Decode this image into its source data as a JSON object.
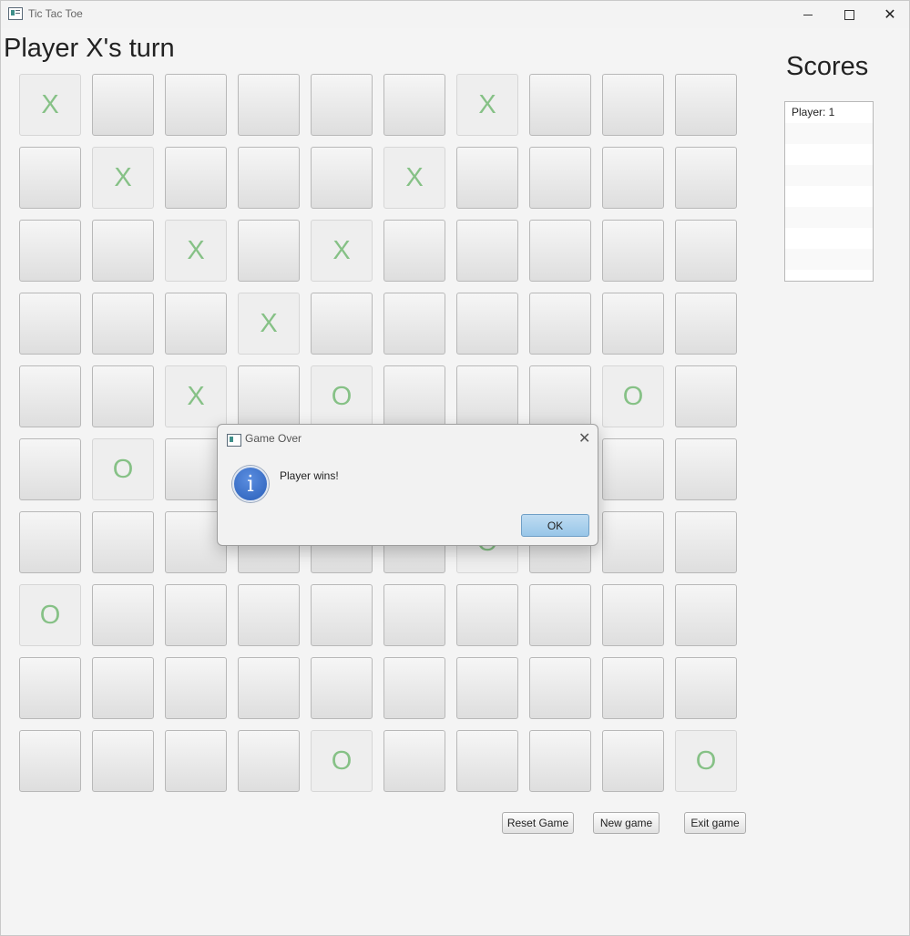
{
  "window": {
    "title": "Tic Tac Toe",
    "close_glyph": "✕"
  },
  "turn_label": "Player X's turn",
  "board": [
    [
      "X",
      "",
      "",
      "",
      "",
      "",
      "X",
      "",
      "",
      ""
    ],
    [
      "",
      "X",
      "",
      "",
      "",
      "X",
      "",
      "",
      "",
      ""
    ],
    [
      "",
      "",
      "X",
      "",
      "X",
      "",
      "",
      "",
      "",
      ""
    ],
    [
      "",
      "",
      "",
      "X",
      "",
      "",
      "",
      "",
      "",
      ""
    ],
    [
      "",
      "",
      "X",
      "",
      "O",
      "",
      "",
      "",
      "O",
      ""
    ],
    [
      "",
      "O",
      "",
      "",
      "",
      "",
      "",
      "",
      "",
      ""
    ],
    [
      "",
      "",
      "",
      "",
      "",
      "",
      "O",
      "",
      "",
      ""
    ],
    [
      "O",
      "",
      "",
      "",
      "",
      "",
      "",
      "",
      "",
      ""
    ],
    [
      "",
      "",
      "",
      "",
      "",
      "",
      "",
      "",
      "",
      ""
    ],
    [
      "",
      "",
      "",
      "",
      "O",
      "",
      "",
      "",
      "",
      "O"
    ]
  ],
  "scores": {
    "title": "Scores",
    "entries": [
      "Player: 1"
    ]
  },
  "buttons": {
    "reset": "Reset Game",
    "new_game": "New game",
    "exit": "Exit game"
  },
  "dialog": {
    "title": "Game Over",
    "message": "Player wins!",
    "ok": "OK",
    "info_glyph": "i",
    "close_glyph": "✕"
  },
  "colors": {
    "mark": "#86c186",
    "ok_button": "#98c6e8",
    "info_icon": "#2a5fb9"
  }
}
